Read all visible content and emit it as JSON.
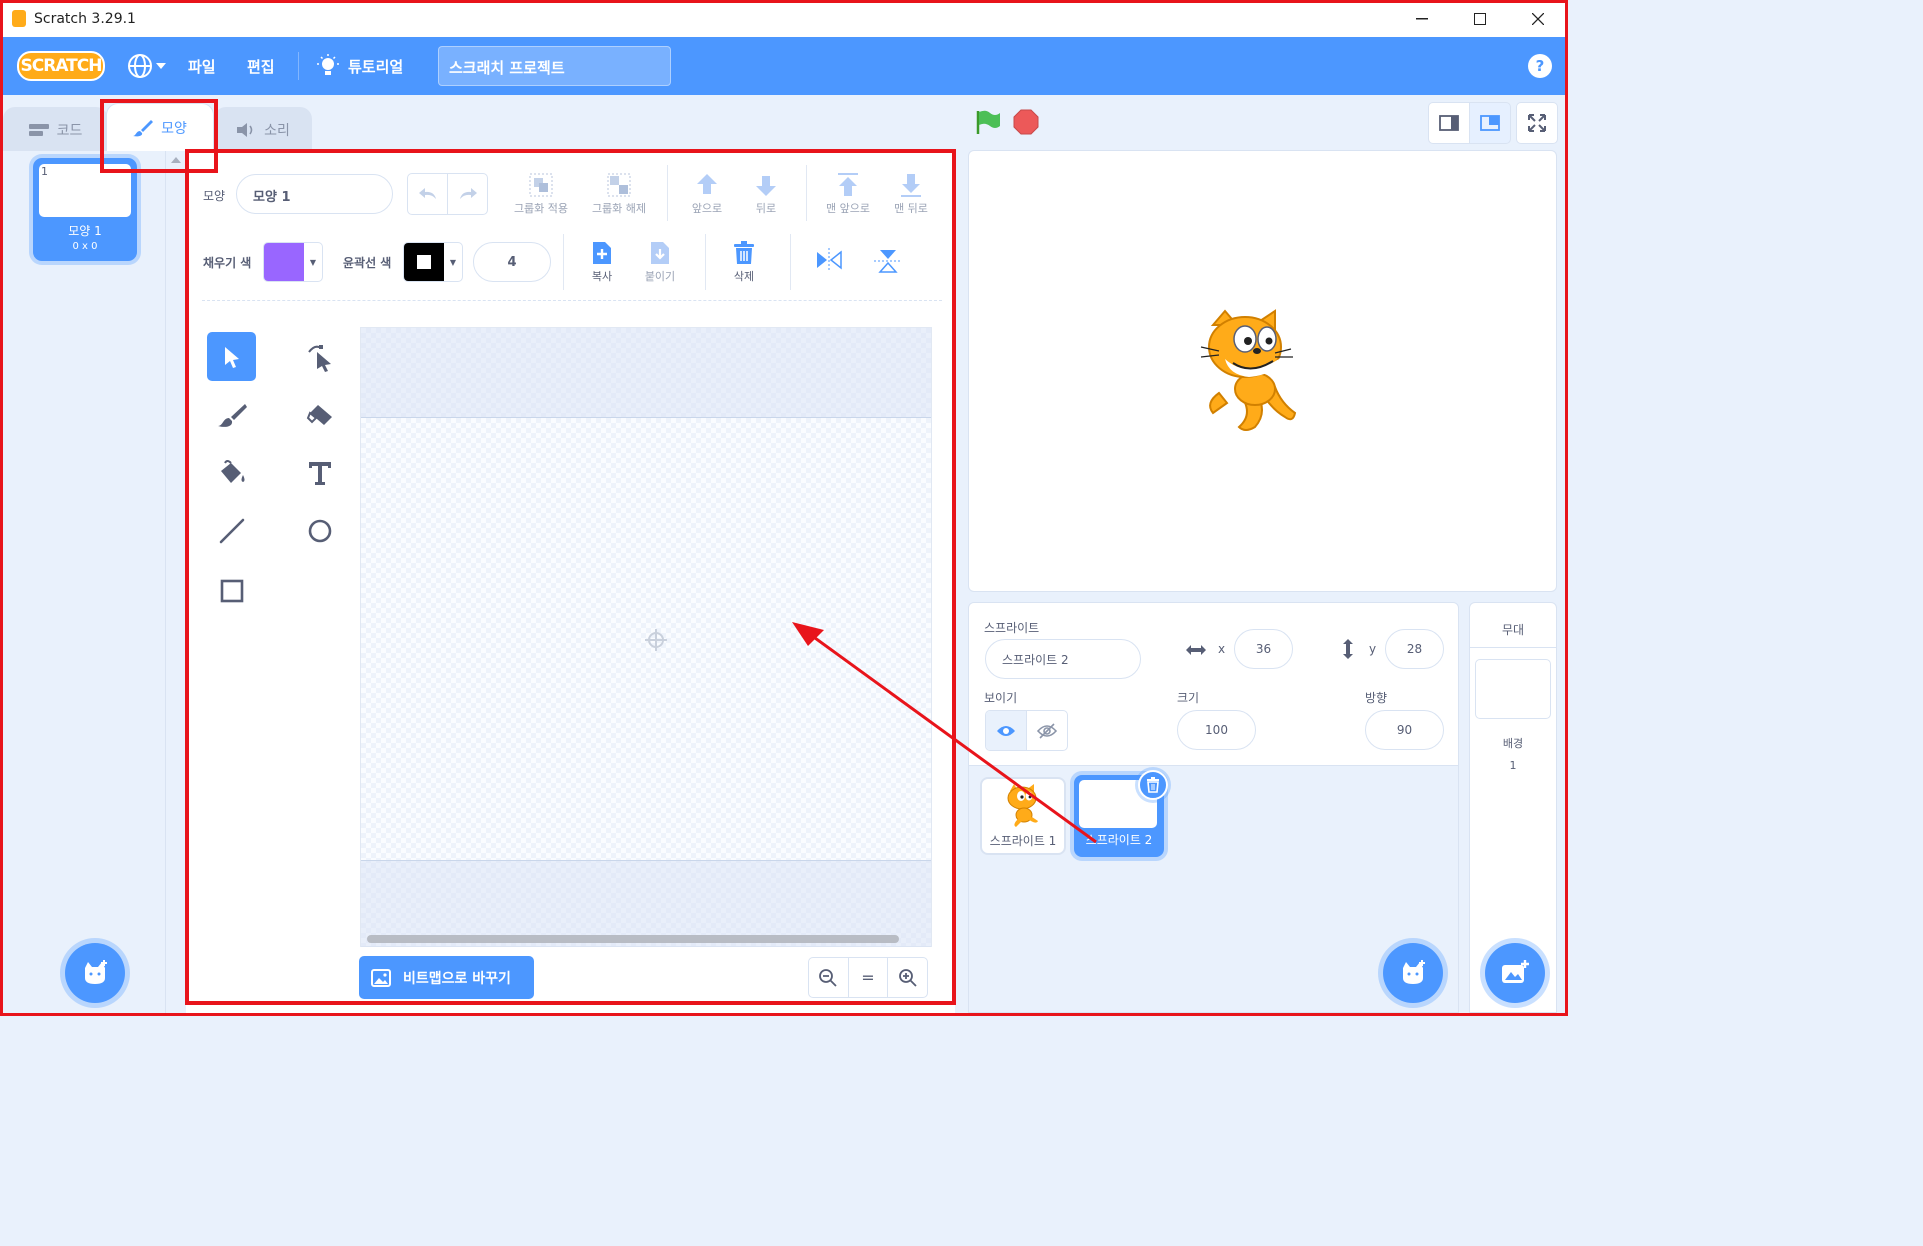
{
  "window": {
    "title": "Scratch 3.29.1",
    "minimize": "—",
    "maximize": "☐",
    "close": "✕"
  },
  "menubar": {
    "logo": "SCRATCH",
    "file": "파일",
    "edit": "편집",
    "tutorials": "튜토리얼",
    "project_title": "스크래치 프로젝트",
    "help": "?"
  },
  "tabs": {
    "code": "코드",
    "costumes": "모양",
    "sounds": "소리"
  },
  "costume_list": {
    "items": [
      {
        "number": "1",
        "name": "모양 1",
        "size": "0 x 0"
      }
    ]
  },
  "paint_editor": {
    "costume_label": "모양",
    "costume_name": "모양 1",
    "group": "그룹화 적용",
    "ungroup": "그룹화 해제",
    "forward": "앞으로",
    "backward": "뒤로",
    "front": "맨 앞으로",
    "back": "맨 뒤로",
    "fill_label": "채우기 색",
    "outline_label": "윤곽선 색",
    "outline_width": "4",
    "copy": "복사",
    "paste": "붙이기",
    "delete": "삭제",
    "fill_color": "#9966ff",
    "outline_color": "#000000",
    "convert_bitmap": "비트맵으로 바꾸기",
    "zoom_reset": "="
  },
  "sprite_info": {
    "sprite_label": "스프라이트",
    "sprite_name": "스프라이트 2",
    "x_label": "x",
    "x": "36",
    "y_label": "y",
    "y": "28",
    "show_label": "보이기",
    "size_label": "크기",
    "size": "100",
    "direction_label": "방향",
    "direction": "90"
  },
  "sprites": [
    {
      "name": "스프라이트 1"
    },
    {
      "name": "스프라이트 2"
    }
  ],
  "stage_panel": {
    "header": "무대",
    "backdrops_label": "배경",
    "backdrops_count": "1"
  },
  "colors": {
    "accent": "#4c97ff",
    "annotation": "#e8141b",
    "cat": "#ffab19"
  }
}
